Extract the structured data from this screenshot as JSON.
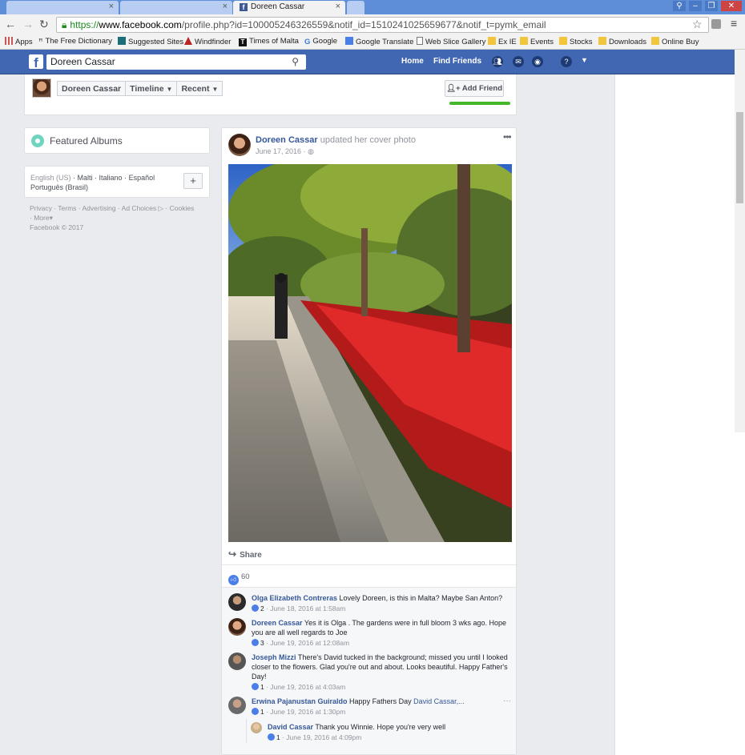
{
  "browser": {
    "tabs": [
      {
        "label": "",
        "active": false
      },
      {
        "label": "",
        "active": false
      },
      {
        "label": "Doreen Cassar",
        "active": true
      },
      {
        "label": "",
        "active": false
      }
    ],
    "url_scheme": "https://",
    "url_host": "www.facebook.com",
    "url_rest": "/profile.php?id=100005246326559&notif_id=1510241025659677&notif_t=pymk_email",
    "bookmarks": [
      {
        "label": "Apps",
        "icon": "apps-grid-icon"
      },
      {
        "label": "The Free Dictionary",
        "icon": "dictionary-icon"
      },
      {
        "label": "Suggested Sites",
        "icon": "bing-icon"
      },
      {
        "label": "Windfinder",
        "icon": "windfinder-icon"
      },
      {
        "label": "Times of Malta",
        "icon": "times-icon"
      },
      {
        "label": "Google",
        "icon": "google-icon"
      },
      {
        "label": "Google Translate",
        "icon": "translate-icon"
      },
      {
        "label": "Web Slice Gallery",
        "icon": "page-icon"
      },
      {
        "label": "Ex IE",
        "icon": "folder-icon"
      },
      {
        "label": "Events",
        "icon": "folder-icon"
      },
      {
        "label": "Stocks",
        "icon": "folder-icon"
      },
      {
        "label": "Downloads",
        "icon": "folder-icon"
      },
      {
        "label": "Online Buy",
        "icon": "folder-icon"
      }
    ]
  },
  "fb": {
    "logo": "f",
    "search_value": "Doreen Cassar",
    "nav": [
      "Home",
      "Find Friends"
    ],
    "colors": {
      "bar": "#4267b2",
      "link": "#365899",
      "green": "#42b72a"
    }
  },
  "profile": {
    "name": "Doreen Cassar",
    "tabs": [
      "Timeline",
      "Recent"
    ],
    "add_friend": "Add Friend"
  },
  "sidebar": {
    "featured_albums": "Featured Albums",
    "languages_current": "English (US)",
    "languages": [
      "Malti",
      "Italiano",
      "Español",
      "Português (Brasil)"
    ],
    "footer_links": [
      "Privacy",
      "Terms",
      "Advertising",
      "Ad Choices",
      "Cookies",
      "More"
    ],
    "copyright": "Facebook © 2017"
  },
  "post": {
    "author": "Doreen Cassar",
    "action": "updated her cover photo",
    "date": "June 17, 2016",
    "share_label": "Share",
    "likes": "60",
    "comments": [
      {
        "author": "Olga Elizabeth Contreras",
        "text": "Lovely Doreen, is this in Malta? Maybe San Anton?",
        "likes": "2",
        "time": "June 18, 2016 at 1:58am"
      },
      {
        "author": "Doreen Cassar",
        "text": "Yes it is Olga . The gardens were in full bloom 3 wks ago. Hope you are all well regards to Joe",
        "likes": "3",
        "time": "June 19, 2016 at 12:08am"
      },
      {
        "author": "Joseph Mizzi",
        "text": "There's David tucked in the background; missed you until I looked closer to the flowers. Glad you're out and about. Looks beautiful. Happy Father's Day!",
        "likes": "1",
        "time": "June 19, 2016 at 4:03am"
      },
      {
        "author": "Erwina Pajanustan Guiraldo",
        "text": "Happy Fathers Day",
        "mention": "David Cassar,...",
        "likes": "1",
        "time": "June 19, 2016 at 1:30pm"
      }
    ],
    "reply": {
      "author": "David Cassar",
      "text": "Thank you Winnie. Hope you're very well",
      "likes": "1",
      "time": "June 19, 2016 at 4:09pm"
    }
  }
}
